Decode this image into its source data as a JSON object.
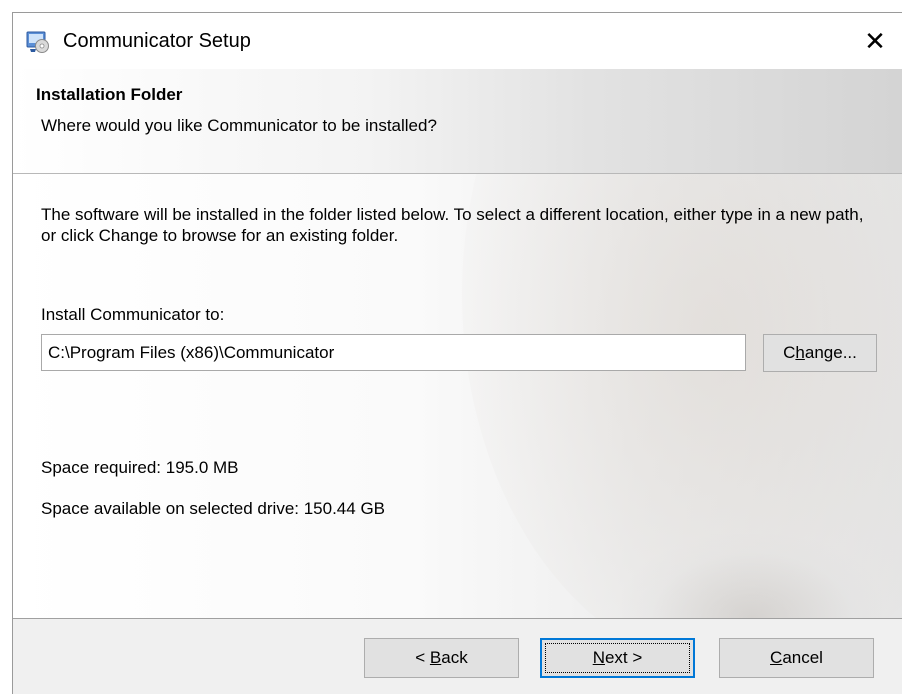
{
  "window": {
    "title": "Communicator Setup",
    "close_symbol": "✕"
  },
  "header": {
    "title": "Installation Folder",
    "subtitle": "Where would you like Communicator to be installed?"
  },
  "body": {
    "description": "The software will be installed in the folder listed below. To select a different location, either type in a new path, or click Change to browse for an existing folder.",
    "install_label": "Install Communicator to:",
    "install_path": "C:\\Program Files (x86)\\Communicator",
    "change_button": {
      "before": "C",
      "accel": "h",
      "after": "ange..."
    },
    "space_required": "Space required: 195.0 MB",
    "space_available": "Space available on selected drive: 150.44 GB"
  },
  "footer": {
    "back_button": {
      "before": "< ",
      "accel": "B",
      "after": "ack"
    },
    "next_button": {
      "before": "",
      "accel": "N",
      "after": "ext >"
    },
    "cancel_button": {
      "before": "",
      "accel": "C",
      "after": "ancel"
    }
  },
  "icons": {
    "app_icon": "installer-setup-icon",
    "close_icon": "close-icon"
  },
  "colors": {
    "focus_border": "#0078d7",
    "button_face": "#e1e1e1",
    "dialog_background": "#f0f0f0"
  }
}
